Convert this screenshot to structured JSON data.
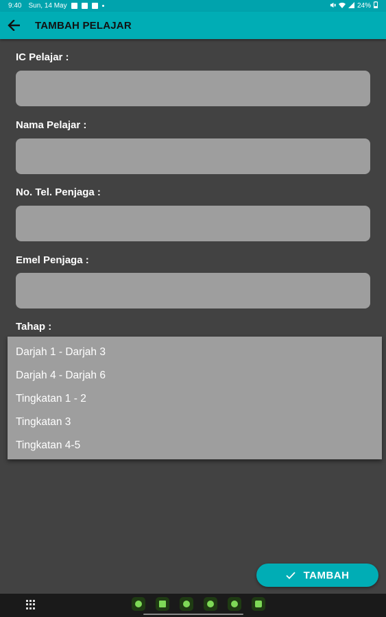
{
  "status_bar": {
    "time": "9:40",
    "date": "Sun, 14 May",
    "battery": "24%"
  },
  "app_bar": {
    "title": "TAMBAH PELAJAR",
    "back_icon": "arrow-left-icon"
  },
  "form": {
    "ic_label": "IC Pelajar :",
    "ic_value": "",
    "name_label": "Nama Pelajar :",
    "name_value": "",
    "phone_label": "No. Tel. Penjaga :",
    "phone_value": "",
    "email_label": "Emel Penjaga :",
    "email_value": "",
    "tahap_label": "Tahap :"
  },
  "dropdown": {
    "options": [
      "Darjah 1 - Darjah 3",
      "Darjah 4 - Darjah 6",
      "Tingkatan 1 - 2",
      "Tingkatan 3",
      "Tingkatan 4-5"
    ]
  },
  "submit": {
    "label": "TAMBAH",
    "icon": "check-icon"
  },
  "colors": {
    "accent": "#00adb5",
    "background": "#424242",
    "field": "#9e9e9e"
  }
}
